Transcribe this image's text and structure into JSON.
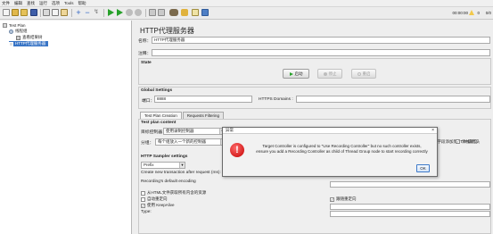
{
  "menubar": {
    "items": [
      "文件",
      "编辑",
      "查找",
      "运行",
      "选项",
      "Tools",
      "帮助"
    ]
  },
  "toolbar": {
    "timer": "00:00:00",
    "warn_count": "0",
    "threads": "0/0",
    "icons": [
      "new-icon",
      "templates-icon",
      "open-icon",
      "save-icon",
      "cut-icon",
      "copy-icon",
      "paste-icon",
      "expand-icon",
      "collapse-icon",
      "toggle-icon",
      "start-icon",
      "start-no-pause-icon",
      "stop-icon",
      "shutdown-icon",
      "clear-icon",
      "clear-all-icon",
      "search-icon",
      "reset-search-icon",
      "function-helper-icon",
      "help-icon"
    ]
  },
  "tree": {
    "items": [
      {
        "label": "Test Plan",
        "level": 0
      },
      {
        "label": "线程组",
        "level": 1
      },
      {
        "label": "查看结果树",
        "level": 2
      },
      {
        "label": "HTTP代理服务器",
        "level": 1,
        "selected": true
      }
    ]
  },
  "main": {
    "title": "HTTP代理服务器",
    "name_label": "名称：",
    "name_value": "HTTP代理服务器",
    "comment_label": "注释：",
    "comment_value": "",
    "state_title": "State",
    "start_label": "启动",
    "stop_label": "停止",
    "restart_label": "重启",
    "global_title": "Global Settings",
    "port_label": "端口：",
    "port_value": "8888",
    "https_label": "HTTPS Domains :",
    "https_value": "",
    "tabs": [
      "Test Plan Creation",
      "Requests Filtering"
    ],
    "test_plan_content_title": "Test plan content",
    "target_label": "目标控制器：",
    "target_value": "使用录制控制器",
    "group_label": "分组：",
    "group_value": "每个组放入一个新的控制器",
    "sampler_title": "HTTP Sampler settings",
    "prefix_value": "Prefix",
    "create_new_tx_label": "Create new transaction after request (ms):",
    "recording_encoding_label": "Recording's default encoding",
    "cb_embedded": "从HTML文件获取所有内含的资源",
    "cb_redirect": "自动重定向",
    "cb_keepalive": "使用 KeepAlive",
    "cb_follow_redirect": "跟随重定向",
    "type_label": "Type:",
    "right_cb_label1": "求中的标题字段添加到HTTP信息头",
    "right_cb_label2": "添加断言"
  },
  "dialog": {
    "title": "异常",
    "line1": "Target Controller is configured to \"Use Recording Controller\" but no such controller exists,",
    "line2": "ensure you add a Recording Controller as child of Thread Group node to start recording correctly",
    "ok_label": "OK"
  }
}
